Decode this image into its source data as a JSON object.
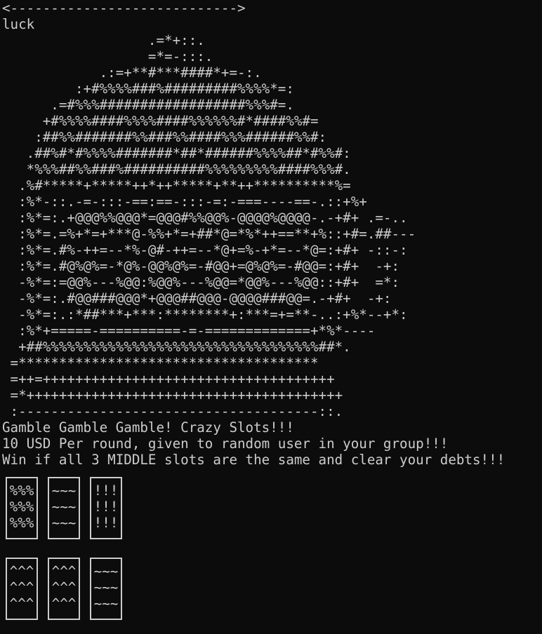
{
  "terminal": {
    "arrow_line": "<---------------------------->",
    "title": "luck",
    "art": [
      "                  .=*+::.",
      "                  =*=-:::.",
      "            .:=+**#***####*+=-:.",
      "         :+#%%%%###%#########%%%%*=:",
      "      .=#%%%##################%%%#=.",
      "     +#%%%%####%%%%####%%%%%%#*####%%#=",
      "    :##%%#######%%###%%####%%%######%%#:",
      "   .##%#*#%%%%#######*##*######%%%%##*#%%#:",
      "   *%%%##%%###%##########%%%%%%%%%####%%%#.",
      "  .%#*****+*****++*++*****+**++**********%=",
      "  :%*-::.-=-:::-==:==-:::-=:-===----==-.::+%+",
      "  :%*=:.+@@@%%@@@*=@@@#%%@@%-@@@@%@@@@-.-+#+ .=-..",
      "  :%*=.=%+*=+***@-%%+*=+##*@=*%*++==**+%::+#=.##---",
      "  :%*=.#%-++=--*%-@#-++=--*@+=%-+*=--*@=:+#+ -::-:",
      "  :%*=.#@%@%=-*@%-@@%@%=-#@@+=@%@%=-#@@=:+#+  -+:",
      "  -%*=:=@@%---%@@:%@@%---%@@=*@@%---%@@::+#+  =*:",
      "  -%*=:.#@@###@@@*+@@@##@@@-@@@@###@@=.-+#+  -+:",
      "  -%*=:.:*##***+***:********+:***=+=**-..:+%*--+*:",
      "  :%*+=====-==========-=-=============+*%*----",
      "  +##%%%%%%%%%%%%%%%%%%%%%%%%%%%%%%%%%%##*.",
      " =*************************************",
      " =++=++++++++++++++++++++++++++++++++++++",
      " =*+++++++++++++++++++++++++++++++++++++++",
      " :-------------------------------------::."
    ],
    "messages": [
      "Gamble Gamble Gamble! Crazy Slots!!!",
      "10 USD Per round, given to random user in your group!!!",
      "Win if all 3 MIDDLE slots are the same and clear your debts!!!"
    ],
    "slot_rows": [
      [
        [
          "%%%",
          "%%%",
          "%%%"
        ],
        [
          "~~~",
          "~~~",
          "~~~"
        ],
        [
          "!!!",
          "!!!",
          "!!!"
        ]
      ],
      [
        [
          "^^^",
          "^^^",
          "^^^"
        ],
        [
          "^^^",
          "^^^",
          "^^^"
        ],
        [
          "~~~",
          "~~~",
          "~~~"
        ]
      ]
    ]
  }
}
